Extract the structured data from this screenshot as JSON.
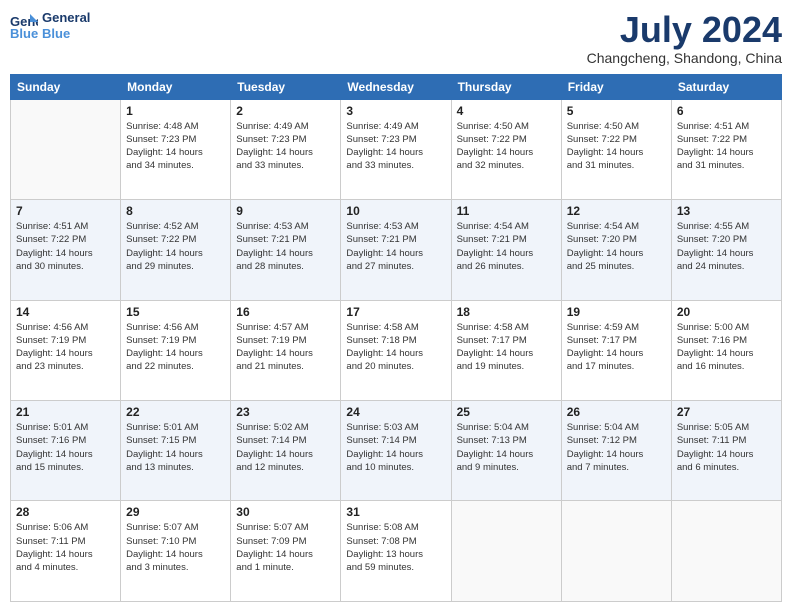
{
  "header": {
    "logo_line1": "General",
    "logo_line2": "Blue",
    "month": "July 2024",
    "location": "Changcheng, Shandong, China"
  },
  "days_of_week": [
    "Sunday",
    "Monday",
    "Tuesday",
    "Wednesday",
    "Thursday",
    "Friday",
    "Saturday"
  ],
  "weeks": [
    [
      {
        "num": "",
        "info": ""
      },
      {
        "num": "1",
        "info": "Sunrise: 4:48 AM\nSunset: 7:23 PM\nDaylight: 14 hours\nand 34 minutes."
      },
      {
        "num": "2",
        "info": "Sunrise: 4:49 AM\nSunset: 7:23 PM\nDaylight: 14 hours\nand 33 minutes."
      },
      {
        "num": "3",
        "info": "Sunrise: 4:49 AM\nSunset: 7:23 PM\nDaylight: 14 hours\nand 33 minutes."
      },
      {
        "num": "4",
        "info": "Sunrise: 4:50 AM\nSunset: 7:22 PM\nDaylight: 14 hours\nand 32 minutes."
      },
      {
        "num": "5",
        "info": "Sunrise: 4:50 AM\nSunset: 7:22 PM\nDaylight: 14 hours\nand 31 minutes."
      },
      {
        "num": "6",
        "info": "Sunrise: 4:51 AM\nSunset: 7:22 PM\nDaylight: 14 hours\nand 31 minutes."
      }
    ],
    [
      {
        "num": "7",
        "info": "Sunrise: 4:51 AM\nSunset: 7:22 PM\nDaylight: 14 hours\nand 30 minutes."
      },
      {
        "num": "8",
        "info": "Sunrise: 4:52 AM\nSunset: 7:22 PM\nDaylight: 14 hours\nand 29 minutes."
      },
      {
        "num": "9",
        "info": "Sunrise: 4:53 AM\nSunset: 7:21 PM\nDaylight: 14 hours\nand 28 minutes."
      },
      {
        "num": "10",
        "info": "Sunrise: 4:53 AM\nSunset: 7:21 PM\nDaylight: 14 hours\nand 27 minutes."
      },
      {
        "num": "11",
        "info": "Sunrise: 4:54 AM\nSunset: 7:21 PM\nDaylight: 14 hours\nand 26 minutes."
      },
      {
        "num": "12",
        "info": "Sunrise: 4:54 AM\nSunset: 7:20 PM\nDaylight: 14 hours\nand 25 minutes."
      },
      {
        "num": "13",
        "info": "Sunrise: 4:55 AM\nSunset: 7:20 PM\nDaylight: 14 hours\nand 24 minutes."
      }
    ],
    [
      {
        "num": "14",
        "info": "Sunrise: 4:56 AM\nSunset: 7:19 PM\nDaylight: 14 hours\nand 23 minutes."
      },
      {
        "num": "15",
        "info": "Sunrise: 4:56 AM\nSunset: 7:19 PM\nDaylight: 14 hours\nand 22 minutes."
      },
      {
        "num": "16",
        "info": "Sunrise: 4:57 AM\nSunset: 7:19 PM\nDaylight: 14 hours\nand 21 minutes."
      },
      {
        "num": "17",
        "info": "Sunrise: 4:58 AM\nSunset: 7:18 PM\nDaylight: 14 hours\nand 20 minutes."
      },
      {
        "num": "18",
        "info": "Sunrise: 4:58 AM\nSunset: 7:17 PM\nDaylight: 14 hours\nand 19 minutes."
      },
      {
        "num": "19",
        "info": "Sunrise: 4:59 AM\nSunset: 7:17 PM\nDaylight: 14 hours\nand 17 minutes."
      },
      {
        "num": "20",
        "info": "Sunrise: 5:00 AM\nSunset: 7:16 PM\nDaylight: 14 hours\nand 16 minutes."
      }
    ],
    [
      {
        "num": "21",
        "info": "Sunrise: 5:01 AM\nSunset: 7:16 PM\nDaylight: 14 hours\nand 15 minutes."
      },
      {
        "num": "22",
        "info": "Sunrise: 5:01 AM\nSunset: 7:15 PM\nDaylight: 14 hours\nand 13 minutes."
      },
      {
        "num": "23",
        "info": "Sunrise: 5:02 AM\nSunset: 7:14 PM\nDaylight: 14 hours\nand 12 minutes."
      },
      {
        "num": "24",
        "info": "Sunrise: 5:03 AM\nSunset: 7:14 PM\nDaylight: 14 hours\nand 10 minutes."
      },
      {
        "num": "25",
        "info": "Sunrise: 5:04 AM\nSunset: 7:13 PM\nDaylight: 14 hours\nand 9 minutes."
      },
      {
        "num": "26",
        "info": "Sunrise: 5:04 AM\nSunset: 7:12 PM\nDaylight: 14 hours\nand 7 minutes."
      },
      {
        "num": "27",
        "info": "Sunrise: 5:05 AM\nSunset: 7:11 PM\nDaylight: 14 hours\nand 6 minutes."
      }
    ],
    [
      {
        "num": "28",
        "info": "Sunrise: 5:06 AM\nSunset: 7:11 PM\nDaylight: 14 hours\nand 4 minutes."
      },
      {
        "num": "29",
        "info": "Sunrise: 5:07 AM\nSunset: 7:10 PM\nDaylight: 14 hours\nand 3 minutes."
      },
      {
        "num": "30",
        "info": "Sunrise: 5:07 AM\nSunset: 7:09 PM\nDaylight: 14 hours\nand 1 minute."
      },
      {
        "num": "31",
        "info": "Sunrise: 5:08 AM\nSunset: 7:08 PM\nDaylight: 13 hours\nand 59 minutes."
      },
      {
        "num": "",
        "info": ""
      },
      {
        "num": "",
        "info": ""
      },
      {
        "num": "",
        "info": ""
      }
    ]
  ]
}
